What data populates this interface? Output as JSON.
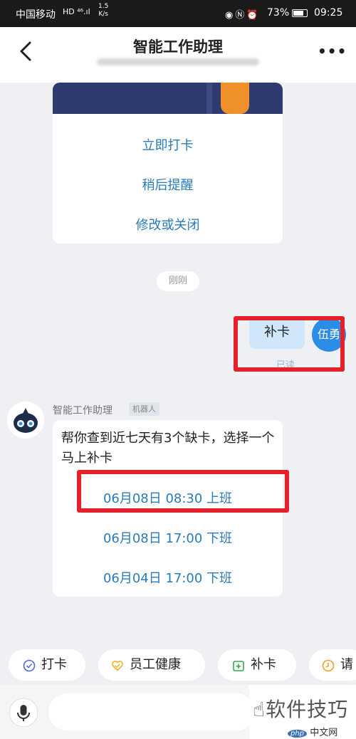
{
  "status_bar": {
    "carrier": "中国移动",
    "network": "HD ⁴⁶.ıl",
    "speed_value": "1.5",
    "speed_unit": "K/s",
    "battery": "73%",
    "time": "09:25"
  },
  "header": {
    "title": "智能工作助理"
  },
  "reminder_card": {
    "options": [
      "立即打卡",
      "稍后提醒",
      "修改或关闭"
    ]
  },
  "timestamp": "刚刚",
  "my_message": {
    "text": "补卡",
    "avatar": "伍勇",
    "read_status": "已读"
  },
  "bot": {
    "name": "智能工作助理",
    "tag": "机器人",
    "message": "帮你查到近七天有3个缺卡，选择一个马上补卡",
    "options": [
      "06月08日 08:30 上班",
      "06月08日 17:00 下班",
      "06月04日 17:00 下班"
    ]
  },
  "quick_actions": [
    {
      "label": "打卡",
      "icon": "check-circle-icon",
      "color": "#4a6cd4"
    },
    {
      "label": "员工健康",
      "icon": "heart-icon",
      "color": "#f0b020"
    },
    {
      "label": "补卡",
      "icon": "calendar-plus-icon",
      "color": "#2eae4e"
    },
    {
      "label": "请",
      "icon": "clock-icon",
      "color": "#f0a020"
    }
  ],
  "watermark": {
    "text": "软件技巧",
    "logo": "php",
    "site": "中文网"
  },
  "colors": {
    "accent_link": "#2a7bb8",
    "my_bubble": "#cfe6fb",
    "avatar": "#2b8de6",
    "highlight_box": "#e5202a"
  }
}
